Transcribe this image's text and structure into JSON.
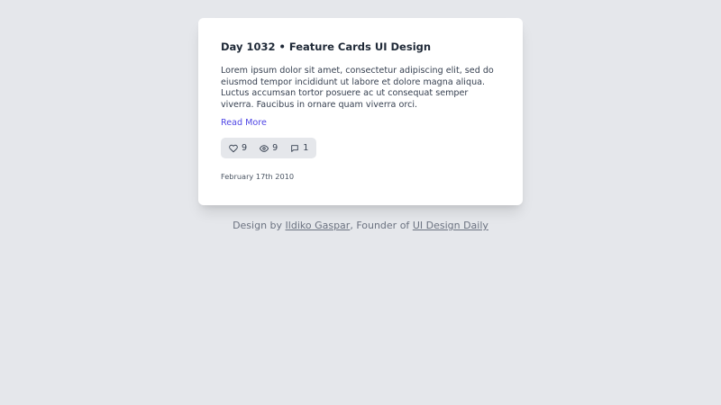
{
  "card": {
    "title": "Day 1032 • Feature Cards UI Design",
    "body": "Lorem ipsum dolor sit amet, consectetur adipiscing elit, sed do eiusmod tempor incididunt ut labore et dolore magna aliqua. Luctus accumsan tortor posuere ac ut consequat semper viverra. Faucibus in ornare quam viverra orci.",
    "read_more": "Read More",
    "stats": {
      "likes": "9",
      "views": "9",
      "comments": "1"
    },
    "date": "February 17th 2010"
  },
  "footer": {
    "prefix": "Design by ",
    "author": "Ildiko Gaspar",
    "middle": ", Founder of ",
    "brand": "UI Design Daily"
  },
  "colors": {
    "background": "#e5e7eb",
    "card": "#ffffff",
    "link": "#4f46e5",
    "title": "#1f2937",
    "stats_bg": "#e5e7eb"
  },
  "icons": [
    "heart-icon",
    "eye-icon",
    "comment-icon"
  ]
}
